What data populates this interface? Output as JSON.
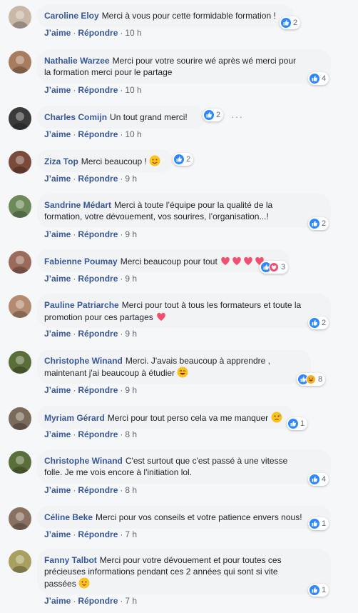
{
  "colors": {
    "name": "#385898",
    "bubble": "#f2f3f5",
    "like": "#2d88ff",
    "love": "#f0506e",
    "haha": "#f7b125"
  },
  "actions": {
    "like": "J’aime",
    "reply": "Répondre",
    "dot": "·"
  },
  "comments": [
    {
      "name": "Caroline Eloy",
      "lines": [
        "Merci à vous pour cette formidable formation !"
      ],
      "reactions": [
        "like"
      ],
      "count": "2",
      "time": "10 h",
      "emoji": ""
    },
    {
      "name": "Nathalie Warzee",
      "lines": [
        "Merci pour votre sourire wé après wé merci pour",
        "la formation merci pour le partage"
      ],
      "reactions": [
        "like"
      ],
      "count": "4",
      "time": "10 h",
      "emoji": ""
    },
    {
      "name": "Charles Comijn",
      "lines": [
        "Un tout grand merci!"
      ],
      "reactions": [
        "like"
      ],
      "count": "2",
      "time": "10 h",
      "emoji": "",
      "more": "···"
    },
    {
      "name": "Ziza Top",
      "lines": [
        "Merci beaucoup !"
      ],
      "reactions": [
        "like"
      ],
      "count": "2",
      "time": "9 h",
      "emoji": "smile"
    },
    {
      "name": "Sandrine Médart",
      "lines": [
        "Merci à toute l’équipe pour la qualité de la",
        "formation, votre dévouement, vos sourires, l’organisation...!"
      ],
      "reactions": [
        "like"
      ],
      "count": "2",
      "time": "9 h",
      "emoji": ""
    },
    {
      "name": "Fabienne Poumay",
      "lines": [
        "Merci beaucoup pour tout"
      ],
      "reactions": [
        "like",
        "love"
      ],
      "count": "3",
      "time": "9 h",
      "emoji": "hearts4"
    },
    {
      "name": "Pauline Patriarche",
      "lines": [
        "Merci pour tout à tous les formateurs et toute la",
        "promotion pour ces partages"
      ],
      "reactions": [
        "like"
      ],
      "count": "2",
      "time": "9 h",
      "emoji": "heart"
    },
    {
      "name": "Christophe Winand",
      "lines": [
        "Merci. J'avais beaucoup à apprendre ,",
        "maintenant j'ai beaucoup à étudier"
      ],
      "reactions": [
        "like",
        "haha"
      ],
      "count": "8",
      "time": "9 h",
      "emoji": "grin"
    },
    {
      "name": "Myriam Gérard",
      "lines": [
        "Merci pour tout perso cela va me manquer"
      ],
      "reactions": [
        "like"
      ],
      "count": "1",
      "time": "8 h",
      "emoji": "sad"
    },
    {
      "name": "Christophe Winand",
      "lines": [
        "C'est surtout que c'est passé à une vitesse",
        "folle. Je me vois encore à l'initiation lol."
      ],
      "reactions": [
        "like"
      ],
      "count": "4",
      "time": "8 h",
      "emoji": ""
    },
    {
      "name": "Céline Beke",
      "lines": [
        "Merci pour vos conseils et votre patience envers nous!"
      ],
      "reactions": [
        "like"
      ],
      "count": "1",
      "time": "7 h",
      "emoji": ""
    },
    {
      "name": "Fanny Talbot",
      "lines": [
        "Merci pour votre dévouement et pour toutes ces",
        "précieuses informations pendant ces 2 années qui sont si vite",
        "passées"
      ],
      "reactions": [
        "like"
      ],
      "count": "1",
      "time": "7 h",
      "emoji": "slight"
    }
  ]
}
